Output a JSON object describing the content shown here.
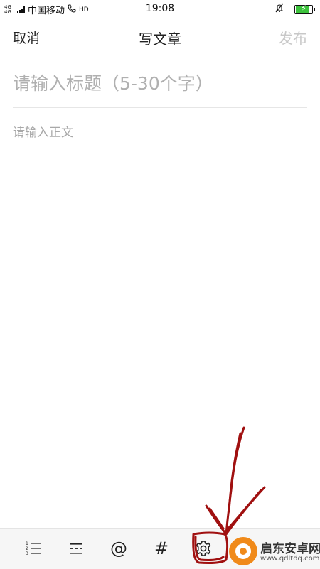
{
  "status_bar": {
    "network_top": "4G 4G",
    "carrier": "中国移动",
    "hd": "HD",
    "time": "19:08",
    "battery_level": 0.78,
    "battery_color": "#3cc23c"
  },
  "nav": {
    "cancel_label": "取消",
    "title": "写文章",
    "publish_label": "发布"
  },
  "editor": {
    "title_placeholder": "请输入标题（5-30个字）",
    "title_value": "",
    "body_placeholder": "请输入正文",
    "body_value": ""
  },
  "toolbar": {
    "items": [
      {
        "icon": "numbered-list-icon"
      },
      {
        "icon": "divider-line-icon"
      },
      {
        "icon": "mention-icon",
        "symbol": "@"
      },
      {
        "icon": "hashtag-icon",
        "symbol": "#"
      },
      {
        "icon": "gear-icon"
      }
    ]
  },
  "watermark": {
    "name": "启东安卓网",
    "url": "www.qdltdq.com"
  },
  "colors": {
    "annotation": "#a01010",
    "publish_disabled": "#c8c8c8"
  }
}
